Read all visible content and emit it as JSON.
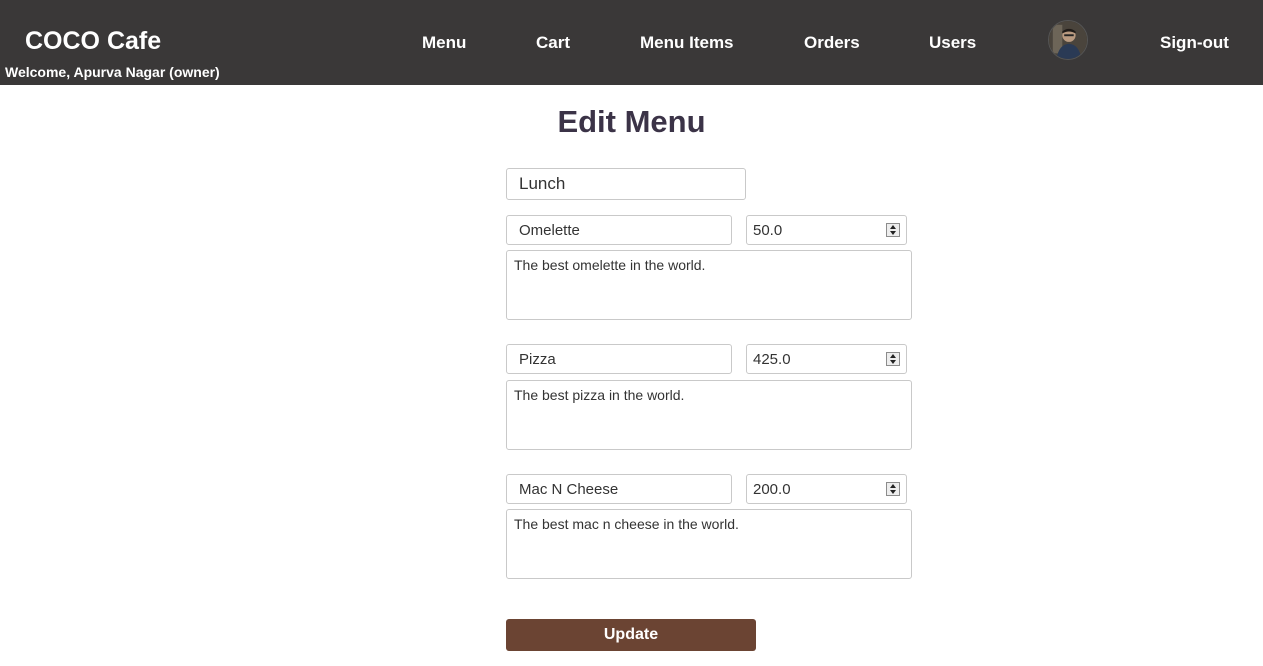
{
  "brand": "COCO Cafe",
  "welcome": "Welcome, Apurva Nagar (owner)",
  "nav": {
    "menu": "Menu",
    "cart": "Cart",
    "menu_items": "Menu Items",
    "orders": "Orders",
    "users": "Users",
    "signout": "Sign-out"
  },
  "avatar_icon": "user-avatar-photo",
  "page_title": "Edit Menu",
  "category": "Lunch",
  "items": [
    {
      "name": "Omelette",
      "price": "50.0",
      "description": "The best omelette in the world."
    },
    {
      "name": "Pizza",
      "price": "425.0",
      "description": "The best pizza in the world."
    },
    {
      "name": "Mac N Cheese",
      "price": "200.0",
      "description": "The best mac n cheese in the world."
    }
  ],
  "update_label": "Update",
  "colors": {
    "navbar": "#3a3838",
    "title": "#3b3347",
    "button": "#6b4433"
  }
}
